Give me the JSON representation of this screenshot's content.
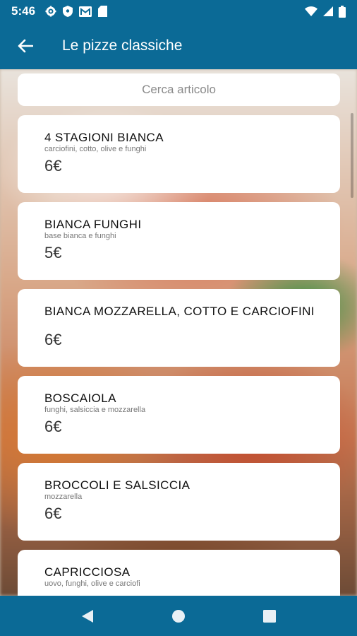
{
  "status_bar": {
    "time": "5:46"
  },
  "header": {
    "title": "Le pizze classiche"
  },
  "search": {
    "placeholder": "Cerca articolo"
  },
  "colors": {
    "primary": "#0b6a96",
    "card": "#ffffff"
  },
  "items": [
    {
      "name": "4 STAGIONI BIANCA",
      "description": "carciofini, cotto, olive e funghi",
      "price": "6€"
    },
    {
      "name": "BIANCA FUNGHI",
      "description": "base bianca e funghi",
      "price": "5€"
    },
    {
      "name": "BIANCA MOZZARELLA, COTTO E CARCIOFINI",
      "description": "",
      "price": "6€"
    },
    {
      "name": "BOSCAIOLA",
      "description": "funghi, salsiccia e mozzarella",
      "price": "6€"
    },
    {
      "name": "BROCCOLI E SALSICCIA",
      "description": "mozzarella",
      "price": "6€"
    },
    {
      "name": "CAPRICCIOSA",
      "description": "uovo, funghi, olive e carciofi",
      "price": ""
    }
  ]
}
